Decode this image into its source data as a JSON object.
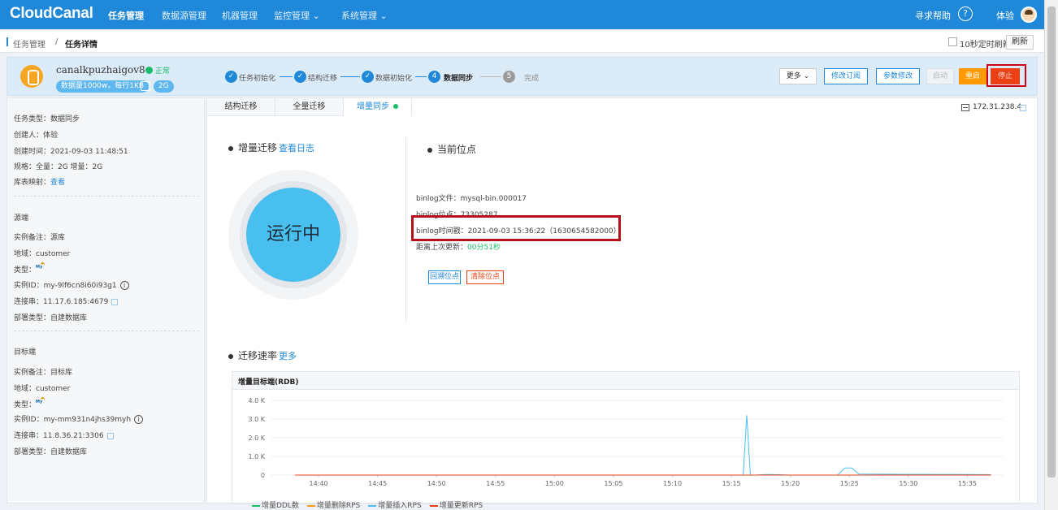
{
  "app": {
    "logo": "CloudCanal",
    "nav": [
      "任务管理",
      "数据源管理",
      "机器管理",
      "监控管理 ⌄",
      "系统管理 ⌄"
    ],
    "help": "寻求帮助",
    "help_icon": "?",
    "user": "体验"
  },
  "breadcrumb": {
    "parent": "任务管理",
    "separator": "/",
    "current": "任务详情",
    "auto_refresh_label": "10秒定时刷新",
    "refresh_label": "刷新"
  },
  "task": {
    "name": "canalkpuzhaigov8",
    "status": "正常",
    "spec": "数据量1000w，每行1KB",
    "size": "2G",
    "steps": [
      {
        "label": "任务初始化",
        "state": "done"
      },
      {
        "label": "结构迁移",
        "state": "done"
      },
      {
        "label": "数据初始化",
        "state": "done"
      },
      {
        "label": "数据同步",
        "state": "current",
        "number": "4"
      },
      {
        "label": "完成",
        "state": "todo",
        "number": "5"
      }
    ],
    "check_mark": "✓",
    "buttons": {
      "more": "更多 ⌄",
      "edit_subscription": "修改订阅",
      "edit_params": "参数修改",
      "start": "启动",
      "restart": "重启",
      "stop": "停止"
    }
  },
  "info": {
    "task_type": "任务类型：数据同步",
    "creator": "创建人：体验",
    "created": "创建时间：2021-09-03 11:48:51",
    "spec": "规格：全量：2G 增量：2G",
    "mapping_label": "库表映射：",
    "mapping_link": "查看",
    "source": {
      "title": "源端",
      "note": "实例备注：源库",
      "region": "地域：customer",
      "type_label": "类型：",
      "id": "实例ID：my-9lf6cn8i60i93g1",
      "conn": "连接串：11.17.6.185:4679",
      "deploy": "部署类型：自建数据库"
    },
    "target": {
      "title": "目标端",
      "note": "实例备注：目标库",
      "region": "地域：customer",
      "type_label": "类型：",
      "id": "实例ID：my-mm931n4jhs39myh",
      "conn": "连接串：11.8.36.21:3306",
      "deploy": "部署类型：自建数据库"
    },
    "info_icon": "i"
  },
  "tabs": [
    "结构迁移",
    "全量迁移",
    "增量同步"
  ],
  "ip": "172.31.238.4",
  "incremental": {
    "title": "增量迁移",
    "log_link": "查看日志",
    "state": "运行中"
  },
  "position": {
    "title": "当前位点",
    "file": "binlog文件：mysql-bin.000017",
    "offset": "binlog位点：73305287",
    "timestamp": "binlog时间戳：2021-09-03 15:36:22（1630654582000）",
    "last_update_label": "距离上次更新：",
    "last_update_value": "00分51秒",
    "rollback": "回溯位点",
    "clear": "清除位点"
  },
  "rate": {
    "title": "迁移速率",
    "more": "更多"
  },
  "chart_data": {
    "type": "line",
    "title": "增量目标端(RDB)",
    "x": [
      "14:40",
      "14:45",
      "14:50",
      "14:55",
      "15:00",
      "15:05",
      "15:10",
      "15:15",
      "15:20",
      "15:25",
      "15:30",
      "15:35"
    ],
    "ylim": [
      0,
      4000
    ],
    "yticks": [
      "0",
      "1.0 K",
      "2.0 K",
      "3.0 K",
      "4.0 K"
    ],
    "grid": true,
    "series": [
      {
        "name": "增量DDL数",
        "color": "#19be6b",
        "points": [
          [
            "14:38",
            0
          ],
          [
            "15:37",
            0
          ]
        ]
      },
      {
        "name": "增量删除RPS",
        "color": "#ff9900",
        "points": [
          [
            "14:38",
            0
          ],
          [
            "15:37",
            0
          ]
        ]
      },
      {
        "name": "增量插入RPS",
        "color": "#49bff0",
        "points": [
          [
            "14:38",
            0
          ],
          [
            "15:16",
            0
          ],
          [
            "15:16.3",
            3200
          ],
          [
            "15:16.6",
            0
          ],
          [
            "15:17",
            0
          ],
          [
            "15:18",
            30
          ],
          [
            "15:19",
            20
          ],
          [
            "15:20",
            0
          ],
          [
            "15:24",
            0
          ],
          [
            "15:24.6",
            380
          ],
          [
            "15:25.2",
            380
          ],
          [
            "15:25.8",
            50
          ],
          [
            "15:30",
            40
          ],
          [
            "15:35",
            30
          ],
          [
            "15:37",
            20
          ]
        ]
      },
      {
        "name": "增量更新RPS",
        "color": "#ed3f14",
        "points": [
          [
            "14:38",
            0
          ],
          [
            "15:37",
            0
          ]
        ]
      }
    ],
    "legend_position": "bottom"
  }
}
